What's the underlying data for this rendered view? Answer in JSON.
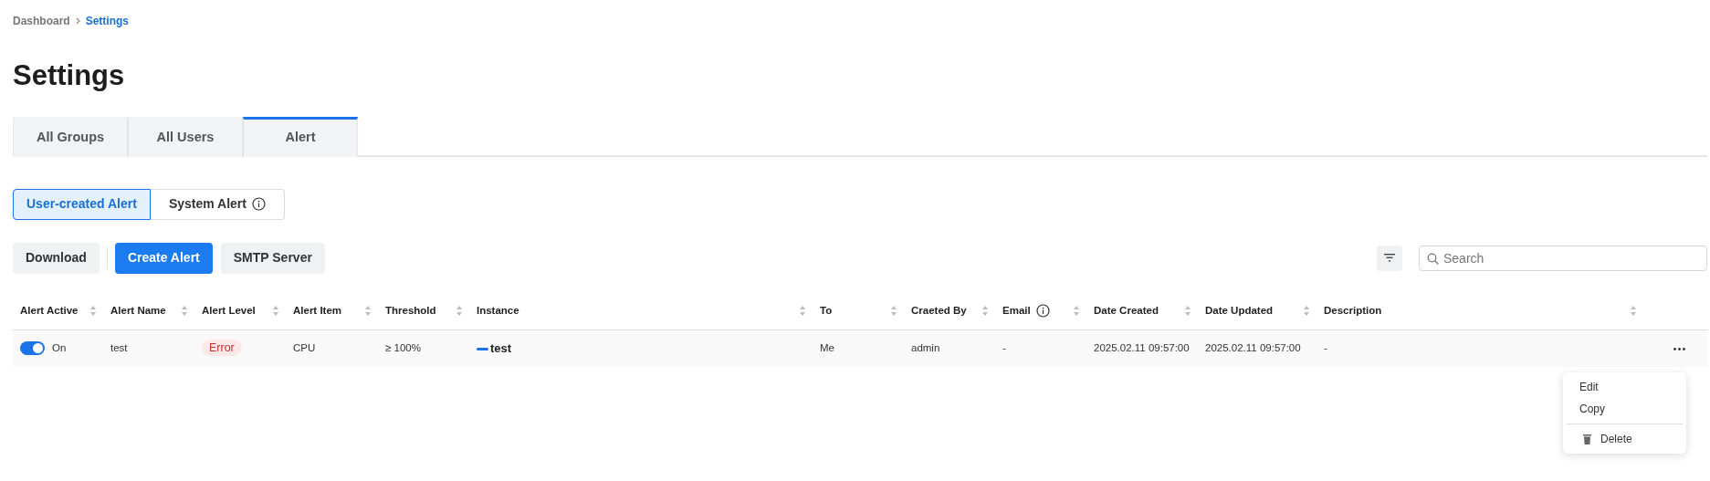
{
  "breadcrumb": [
    {
      "label": "Dashboard",
      "current": false
    },
    {
      "label": "Settings",
      "current": true
    }
  ],
  "title": "Settings",
  "tabs": [
    {
      "label": "All Groups",
      "selected": false
    },
    {
      "label": "All Users",
      "selected": false
    },
    {
      "label": "Alert",
      "selected": true
    }
  ],
  "segments": [
    {
      "label": "User-created Alert",
      "selected": true,
      "info": false
    },
    {
      "label": "System Alert",
      "selected": false,
      "info": true
    }
  ],
  "toolbar": [
    {
      "label": "Download",
      "kind": "secondary"
    },
    {
      "label": "Create Alert",
      "kind": "primary"
    },
    {
      "label": "SMTP Server",
      "kind": "secondary"
    }
  ],
  "search": {
    "placeholder": "Search"
  },
  "table": {
    "columns": [
      {
        "label": "Alert Active",
        "info": false
      },
      {
        "label": "Alert Name",
        "info": false
      },
      {
        "label": "Alert Level",
        "info": false
      },
      {
        "label": "Alert Item",
        "info": false
      },
      {
        "label": "Threshold",
        "info": false
      },
      {
        "label": "Instance",
        "info": false
      },
      {
        "label": "To",
        "info": false
      },
      {
        "label": "Craeted By",
        "info": false
      },
      {
        "label": "Email",
        "info": true
      },
      {
        "label": "Date Created",
        "info": false
      },
      {
        "label": "Date Updated",
        "info": false
      },
      {
        "label": "Description",
        "info": false
      }
    ],
    "rows": [
      {
        "active": true,
        "active_label": "On",
        "name": "test",
        "alert_level": {
          "label": "Error",
          "kind": "error"
        },
        "item": "CPU",
        "threshold": "≥ 100%",
        "instance": {
          "label": "test",
          "color": "#1a73e8"
        },
        "to": "Me",
        "created_by": "admin",
        "email": "-",
        "date_created": "2025.02.11 09:57:00",
        "date_updated": "2025.02.11 09:57:00",
        "description": "-"
      }
    ]
  },
  "context_menu": [
    {
      "label": "Edit",
      "kind": "plain"
    },
    {
      "label": "Copy",
      "kind": "plain"
    },
    {
      "label": "Delete",
      "kind": "delete"
    }
  ]
}
